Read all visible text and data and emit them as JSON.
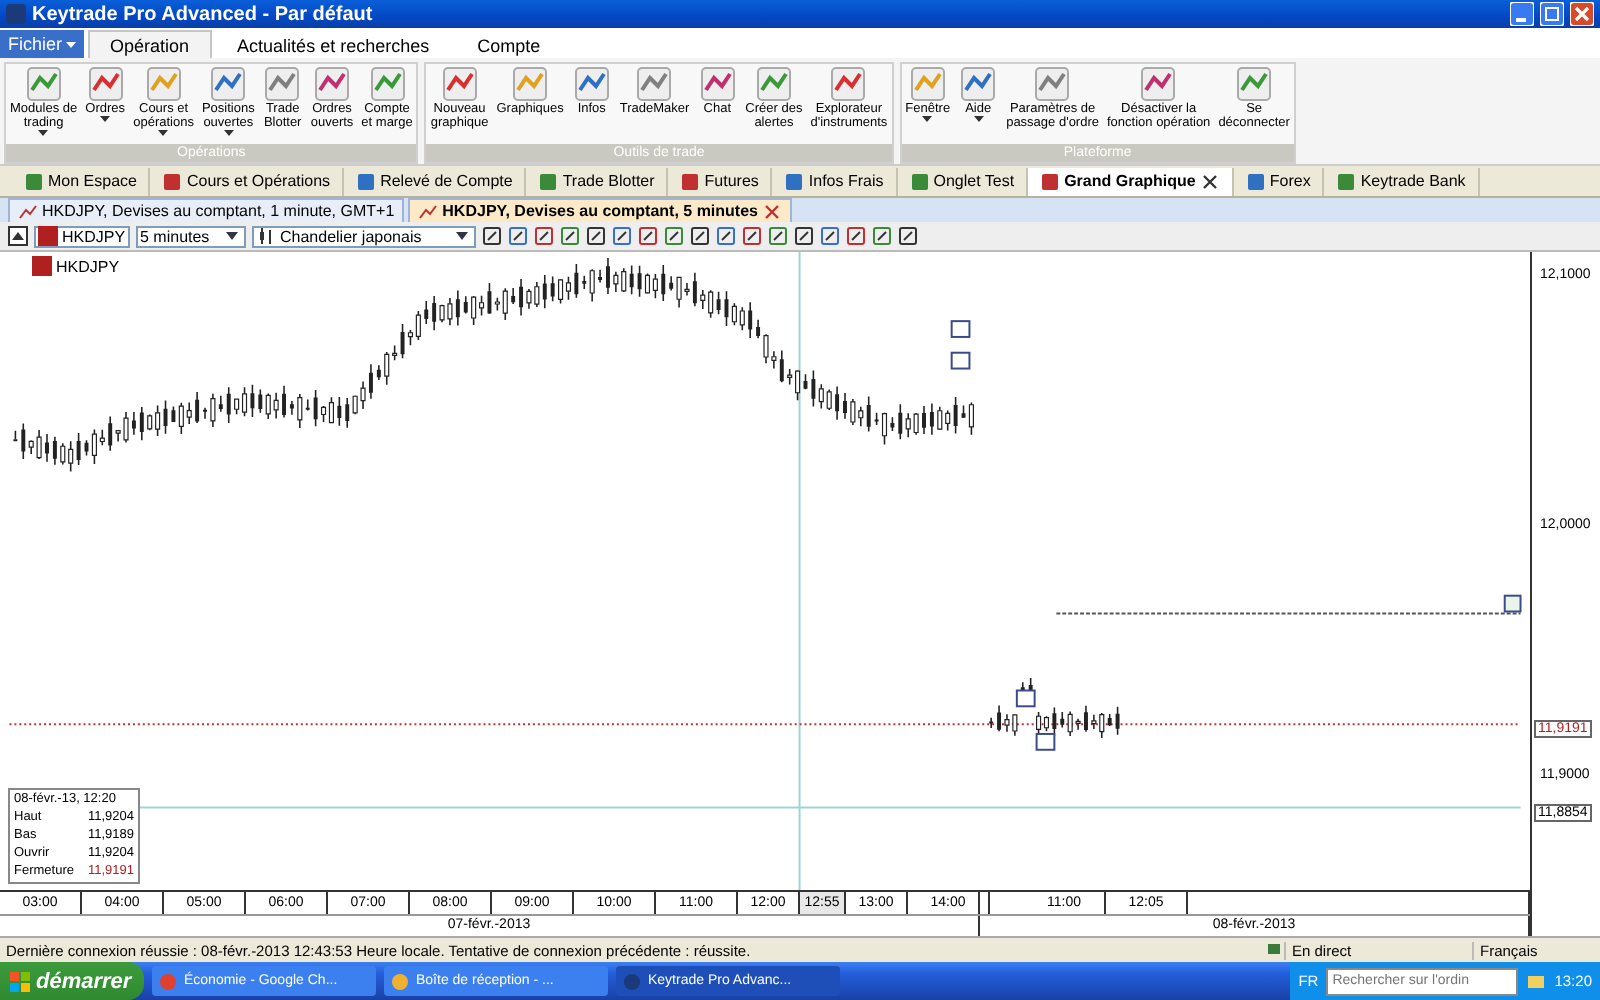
{
  "window": {
    "title": "Keytrade Pro Advanced - Par défaut"
  },
  "ribbon": {
    "menu_button": "Fichier",
    "tabs": [
      {
        "label": "Opération",
        "selected": true
      },
      {
        "label": "Actualités et recherches",
        "selected": false
      },
      {
        "label": "Compte",
        "selected": false
      }
    ],
    "groups": [
      {
        "label": "Opérations",
        "buttons": [
          {
            "label": "Modules de\ntrading",
            "has_menu": true
          },
          {
            "label": "Ordres",
            "has_menu": true
          },
          {
            "label": "Cours et\nopérations",
            "has_menu": true
          },
          {
            "label": "Positions\nouvertes",
            "has_menu": true
          },
          {
            "label": "Trade\nBlotter",
            "has_menu": false
          },
          {
            "label": "Ordres\nouverts",
            "has_menu": false
          },
          {
            "label": "Compte\net marge",
            "has_menu": false
          }
        ]
      },
      {
        "label": "Outils de trade",
        "buttons": [
          {
            "label": "Nouveau\ngraphique",
            "has_menu": false
          },
          {
            "label": "Graphiques",
            "has_menu": false
          },
          {
            "label": "Infos",
            "has_menu": false
          },
          {
            "label": "TradeMaker",
            "has_menu": false
          },
          {
            "label": "Chat",
            "has_menu": false
          },
          {
            "label": "Créer des\nalertes",
            "has_menu": false
          },
          {
            "label": "Explorateur\nd'instruments",
            "has_menu": false
          }
        ]
      },
      {
        "label": "Plateforme",
        "buttons": [
          {
            "label": "Fenêtre",
            "has_menu": true
          },
          {
            "label": "Aide",
            "has_menu": true
          },
          {
            "label": "Paramètres de\npassage d'ordre",
            "has_menu": false
          },
          {
            "label": "Désactiver la\nfonction opération",
            "has_menu": false
          },
          {
            "label": "Se\ndéconnecter",
            "has_menu": false
          }
        ]
      }
    ]
  },
  "workspace_tabs": [
    {
      "label": "Mon Espace",
      "selected": false
    },
    {
      "label": "Cours et Opérations",
      "selected": false
    },
    {
      "label": "Relevé de Compte",
      "selected": false
    },
    {
      "label": "Trade Blotter",
      "selected": false
    },
    {
      "label": "Futures",
      "selected": false
    },
    {
      "label": "Infos Frais",
      "selected": false
    },
    {
      "label": "Onglet Test",
      "selected": false
    },
    {
      "label": "Grand Graphique",
      "selected": true
    },
    {
      "label": "Forex",
      "selected": false
    },
    {
      "label": "Keytrade Bank",
      "selected": false
    }
  ],
  "chart_tabs": [
    {
      "label": "HKDJPY, Devises au comptant, 1 minute, GMT+1",
      "selected": false
    },
    {
      "label": "HKDJPY, Devises au comptant, 5 minutes",
      "selected": true
    }
  ],
  "toolbar": {
    "symbol": "HKDJPY",
    "interval": "5 minutes",
    "chart_type": "Chandelier japonais"
  },
  "chart": {
    "legend": "HKDJPY",
    "info_box": {
      "date": "08-févr.-13, 12:20",
      "rows": [
        {
          "label": "Haut",
          "value": "11,9204",
          "kind": "plain"
        },
        {
          "label": "Bas",
          "value": "11,9189",
          "kind": "plain"
        },
        {
          "label": "Ouvrir",
          "value": "11,9204",
          "kind": "plain"
        },
        {
          "label": "Fermeture",
          "value": "11,9191",
          "kind": "close"
        }
      ]
    },
    "price_ticks": [
      "12,1000",
      "12,0000",
      "11,9000"
    ],
    "last_price": "11,9191",
    "cursor_price": "11,8854",
    "sessions": [
      {
        "date": "07-févr.-2013",
        "ticks": [
          {
            "label": "03:00",
            "selected": false
          },
          {
            "label": "04:00",
            "selected": false
          },
          {
            "label": "05:00",
            "selected": false
          },
          {
            "label": "06:00",
            "selected": false
          },
          {
            "label": "07:00",
            "selected": false
          },
          {
            "label": "08:00",
            "selected": false
          },
          {
            "label": "09:00",
            "selected": false
          },
          {
            "label": "10:00",
            "selected": false
          },
          {
            "label": "11:00",
            "selected": false
          },
          {
            "label": "12:00",
            "selected": false
          },
          {
            "label": "12:55",
            "selected": true
          },
          {
            "label": "13:00",
            "selected": false
          },
          {
            "label": "14:00",
            "selected": false
          }
        ]
      },
      {
        "date": "08-févr.-2013",
        "ticks": [
          {
            "label": "11:00",
            "selected": false
          },
          {
            "label": "12:05",
            "selected": false
          }
        ]
      }
    ]
  },
  "status_bar": {
    "message": "Dernière connexion réussie : 08-févr.-2013 12:43:53 Heure locale. Tentative de connexion précédente : réussite.",
    "connection": "En direct",
    "language": "Français"
  },
  "taskbar": {
    "start": "démarrer",
    "tasks": [
      {
        "label": "Économie - Google Ch...",
        "selected": false
      },
      {
        "label": "Boîte de réception - ...",
        "selected": false
      },
      {
        "label": "Keytrade Pro Advanc...",
        "selected": true
      }
    ],
    "input_language": "FR",
    "search_placeholder": "Rechercher sur l'ordin",
    "clock": "13:20"
  }
}
